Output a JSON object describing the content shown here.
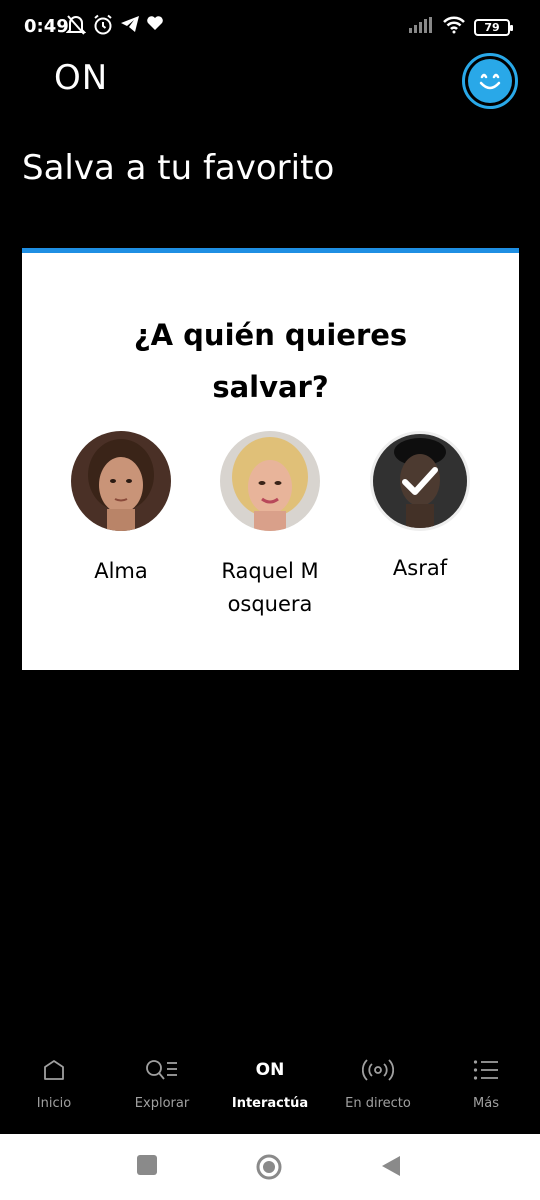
{
  "status_bar": {
    "time": "0:49",
    "battery": "79"
  },
  "header": {
    "logo": "ON"
  },
  "page": {
    "title": "Salva a tu favorito"
  },
  "card": {
    "question": "¿A quién quieres salvar?",
    "candidates": [
      {
        "name": "Alma",
        "selected": false
      },
      {
        "name": "Raquel Mosquera",
        "selected": false
      },
      {
        "name": "Asraf",
        "selected": true
      }
    ]
  },
  "bottom_nav": {
    "items": [
      {
        "label": "Inicio",
        "icon": "home-icon"
      },
      {
        "label": "Explorar",
        "icon": "search-list-icon"
      },
      {
        "label": "Interactúa",
        "icon": "on-logo-icon",
        "active": true
      },
      {
        "label": "En directo",
        "icon": "live-broadcast-icon"
      },
      {
        "label": "Más",
        "icon": "menu-list-icon"
      }
    ],
    "on_icon_text": "ON"
  },
  "colors": {
    "accent": "#1f8fe3",
    "profile": "#29a8e8"
  }
}
